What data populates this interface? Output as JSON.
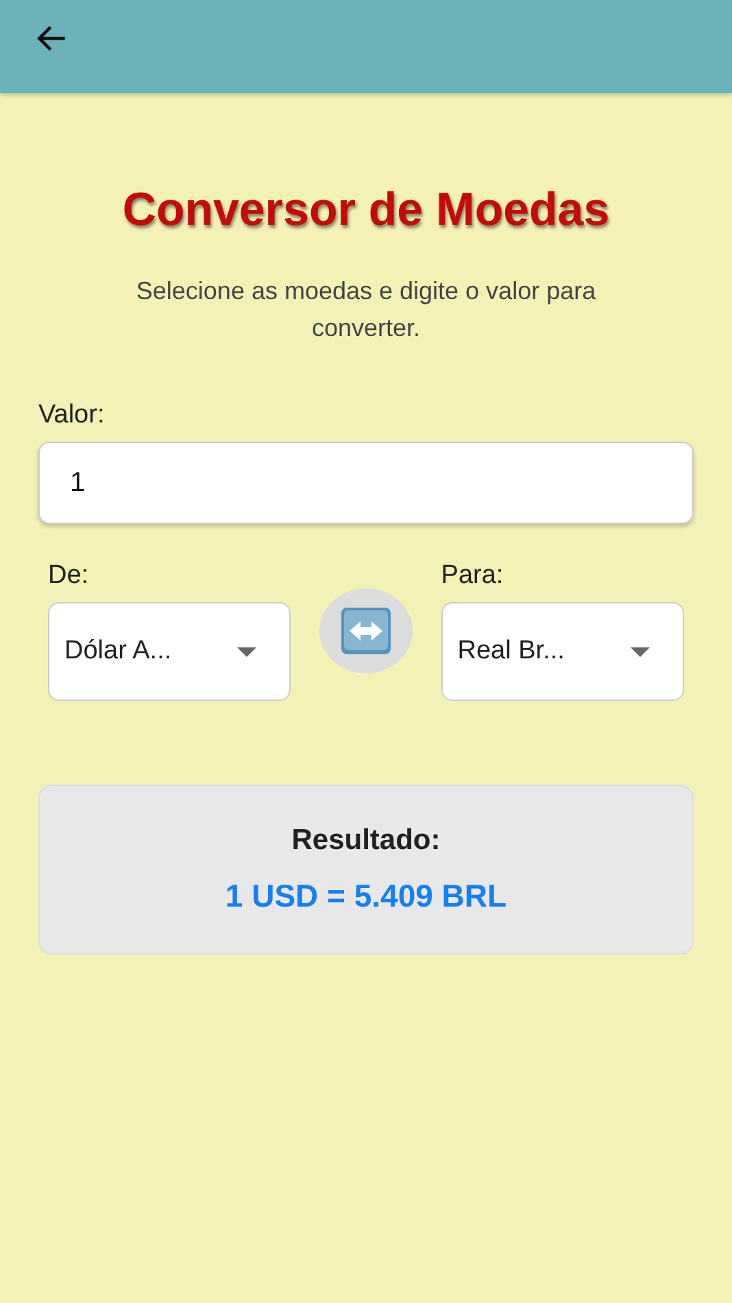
{
  "title": "Conversor de Moedas",
  "subtitle": "Selecione as moedas e digite o valor para converter.",
  "amount": {
    "label": "Valor:",
    "value": "1"
  },
  "from": {
    "label": "De:",
    "value": "Dólar A..."
  },
  "to": {
    "label": "Para:",
    "value": "Real Br..."
  },
  "result": {
    "label": "Resultado:",
    "value": "1 USD = 5.409 BRL"
  }
}
